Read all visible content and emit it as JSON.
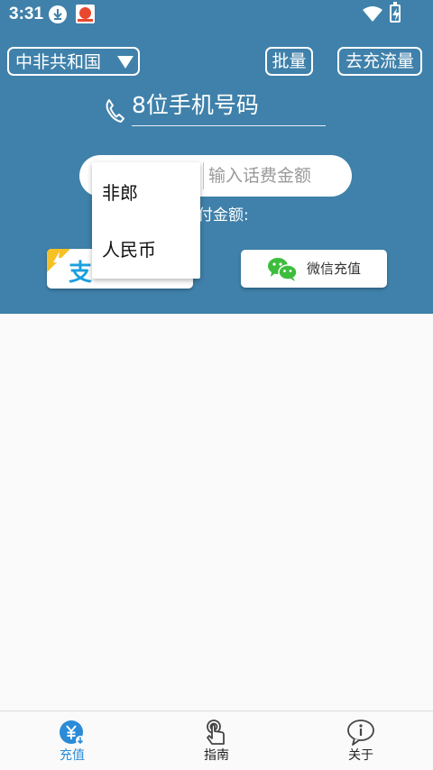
{
  "status_bar": {
    "time": "3:31",
    "icons": [
      "download-icon",
      "app-notification-icon",
      "wifi-icon",
      "battery-charging-icon"
    ]
  },
  "header": {
    "country_selected": "中非共和国",
    "batch_label": "批量",
    "data_recharge_label": "去充流量"
  },
  "form": {
    "phone_placeholder": "8位手机号码",
    "amount_placeholder": "输入话费金额",
    "pay_amount_label": "付金额:"
  },
  "currency_dropdown": {
    "options": [
      "非郎",
      "人民币"
    ]
  },
  "payment": {
    "alipay_glyph": "支",
    "wechat_label": "微信充值"
  },
  "bottom_nav": {
    "items": [
      {
        "label": "充值",
        "icon": "yuan-recharge-icon",
        "active": true
      },
      {
        "label": "指南",
        "icon": "tap-guide-icon",
        "active": false
      },
      {
        "label": "关于",
        "icon": "info-icon",
        "active": false
      }
    ]
  },
  "colors": {
    "primary": "#3f81aa",
    "nav_active": "#2a8bd8",
    "wechat_green": "#3dbd3d",
    "alipay_blue": "#1a9fe0"
  }
}
